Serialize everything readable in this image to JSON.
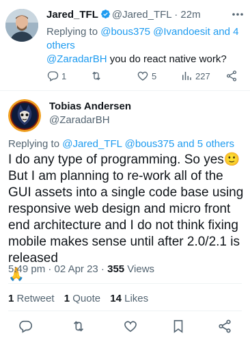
{
  "reply_tweet": {
    "name": "Jared_TFL",
    "handle": "@Jared_TFL",
    "separator": "·",
    "time": "22m",
    "replying_prefix": "Replying to ",
    "replying_handles": "@bous375 @Ivandoesit",
    "replying_and": " and ",
    "replying_more": "4 others",
    "mention": "@ZaradarBH",
    "text": " you do react native work?",
    "replies": "1",
    "retweets": "",
    "likes": "5",
    "views": "227",
    "colors": {
      "accent": "#1d9bf0",
      "muted": "#536471"
    }
  },
  "main_tweet": {
    "name": "Tobias Andersen",
    "handle": "@ZaradarBH",
    "replying_prefix": "Replying to ",
    "replying_handles": "@Jared_TFL @bous375",
    "replying_and": " and ",
    "replying_more": "5 others",
    "text_line1": "I do any type of programming. So yes🙂",
    "text_body": "But I am planning to re-work all of the GUI assets into a single code base using responsive web design and micro front end architecture and I do not think fixing mobile makes sense until after 2.0/2.1 is released",
    "emoji_end": "🙏",
    "time": "5:49 pm",
    "date": "02 Apr 23",
    "sep": " · ",
    "views_count": "355",
    "views_label": " Views",
    "retweets_count": "1",
    "retweets_label": " Retweet",
    "quotes_count": "1",
    "quotes_label": " Quote",
    "likes_count": "14",
    "likes_label": " Likes"
  },
  "icons": [
    "more-icon",
    "verified-icon",
    "reply-icon",
    "retweet-icon",
    "like-icon",
    "views-icon",
    "share-icon",
    "bookmark-icon"
  ]
}
